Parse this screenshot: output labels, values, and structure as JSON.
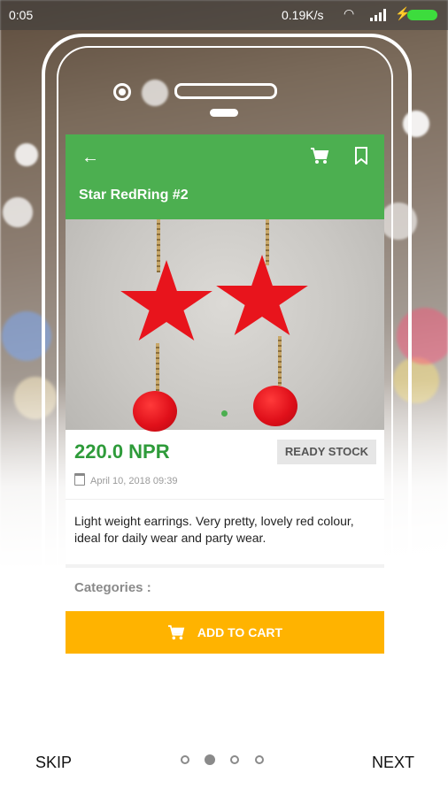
{
  "status_bar": {
    "time": "0:05",
    "network_speed": "0.19K/s",
    "icons": [
      "wifi-icon",
      "signal-icon",
      "charging-icon",
      "battery-icon"
    ]
  },
  "product_screen": {
    "title": "Star RedRing #2",
    "appbar_icons": [
      "back-arrow-icon",
      "cart-icon",
      "bookmark-icon"
    ],
    "price": "220.0 NPR",
    "stock_badge": "READY STOCK",
    "date": "April 10, 2018 09:39",
    "description": "Light weight earrings. Very pretty, lovely red colour, ideal for daily wear and party wear.",
    "categories_label": "Categories :",
    "add_to_cart_label": "ADD TO CART"
  },
  "colors": {
    "appbar": "#4caf50",
    "price": "#2e9b3a",
    "add_to_cart": "#ffb300"
  },
  "onboarding": {
    "skip_label": "SKIP",
    "next_label": "NEXT",
    "page_count": 4,
    "active_page": 2
  }
}
